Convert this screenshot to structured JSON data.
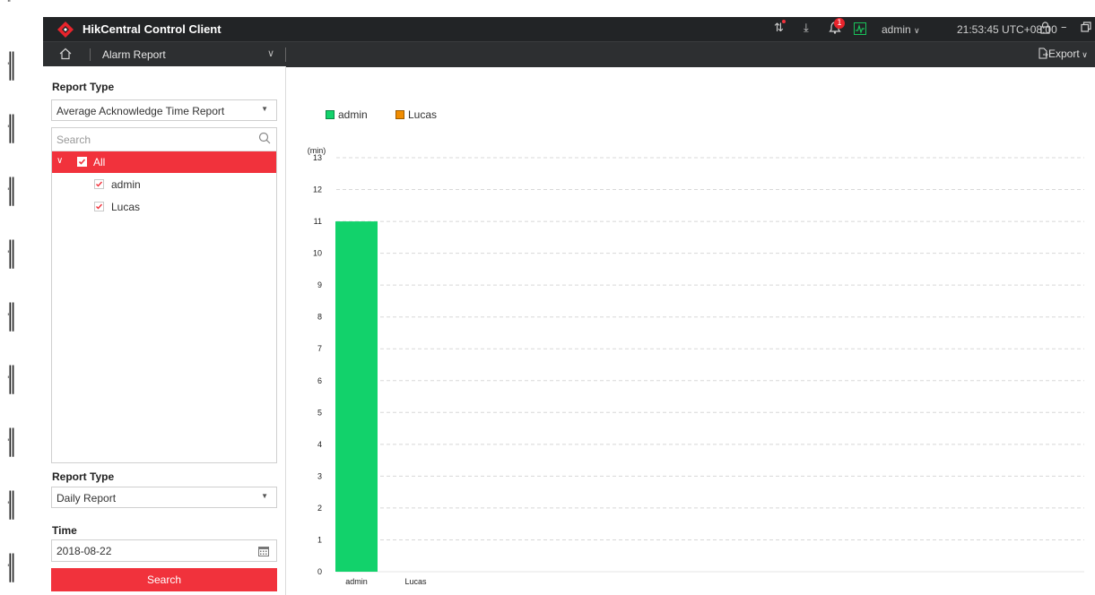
{
  "app": {
    "title": "HikCentral Control Client",
    "user": "admin",
    "clock": "21:53:45 UTC+08:00",
    "accent_color": "#f1323c",
    "notification_count": "1"
  },
  "tab": {
    "title": "Alarm Report",
    "export_label": "Export"
  },
  "sidebar": {
    "report_type_label": "Report Type",
    "report_type_value": "Average Acknowledge Time Report",
    "tree_search_placeholder": "Search",
    "tree_all_label": "All",
    "tree_items": [
      {
        "label": "admin",
        "checked": true
      },
      {
        "label": "Lucas",
        "checked": true
      }
    ],
    "period_label": "Report Type",
    "period_value": "Daily Report",
    "time_label": "Time",
    "time_value": "2018-08-22",
    "search_button": "Search"
  },
  "chart_data": {
    "type": "bar",
    "categories": [
      "admin",
      "Lucas"
    ],
    "series": [
      {
        "name": "admin",
        "color": "#12d26b",
        "values": [
          11,
          null
        ]
      },
      {
        "name": "Lucas",
        "color": "#f08c00",
        "values": [
          null,
          0
        ]
      }
    ],
    "ylabel": "(min)",
    "ylim": [
      0,
      13
    ],
    "yticks": [
      0,
      1,
      2,
      3,
      4,
      5,
      6,
      7,
      8,
      9,
      10,
      11,
      12,
      13
    ],
    "grid": true,
    "legend": "top-left"
  }
}
